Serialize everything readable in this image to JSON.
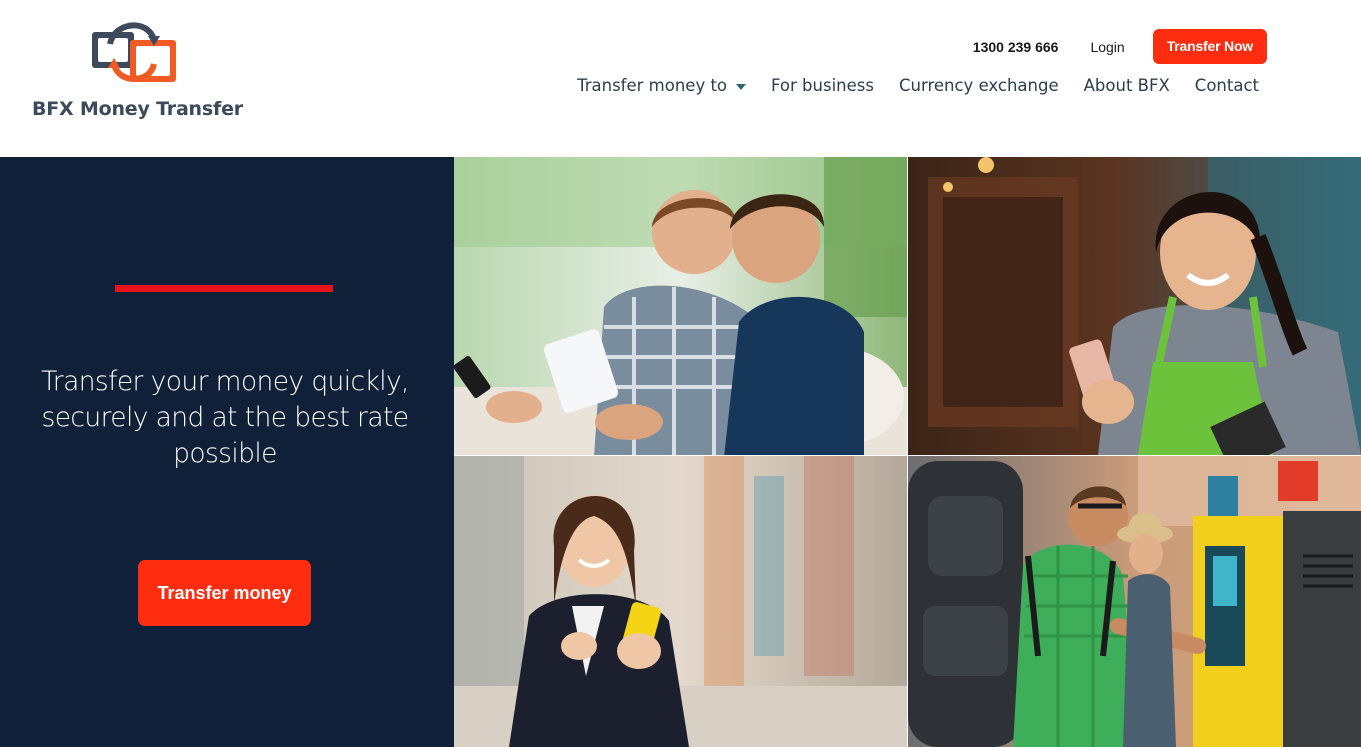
{
  "brand": {
    "name": "BFX Money Transfer",
    "colors": {
      "navy": "#0f2038",
      "accent": "#ff2d0f",
      "logo_grey": "#3c4a5c",
      "logo_orange": "#f15a22"
    }
  },
  "header": {
    "phone": "1300 239 666",
    "login": "Login",
    "cta": "Transfer Now"
  },
  "nav": {
    "items": [
      {
        "label": "Transfer money to",
        "has_dropdown": true
      },
      {
        "label": "For business"
      },
      {
        "label": "Currency exchange"
      },
      {
        "label": "About BFX"
      },
      {
        "label": "Contact"
      }
    ]
  },
  "hero": {
    "tagline": "Transfer your money quickly, securely and at the best rate possible",
    "button": "Transfer money"
  },
  "photos": [
    {
      "icon": "photo-two-men-with-phone-and-tablet"
    },
    {
      "icon": "photo-smiling-woman-in-apron-with-phone"
    },
    {
      "icon": "photo-woman-in-blazer-with-yellow-phone"
    },
    {
      "icon": "photo-backpackers-at-atm-kiosk"
    }
  ]
}
